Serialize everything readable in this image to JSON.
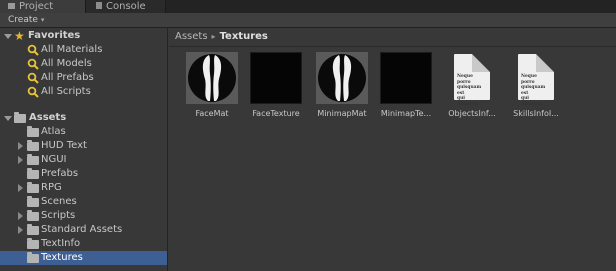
{
  "tabs": [
    {
      "label": "Project"
    },
    {
      "label": "Console"
    }
  ],
  "toolbar": {
    "create_label": "Create",
    "create_caret": "▾"
  },
  "favorites": {
    "header": "Favorites",
    "items": [
      {
        "label": "All Materials"
      },
      {
        "label": "All Models"
      },
      {
        "label": "All Prefabs"
      },
      {
        "label": "All Scripts"
      }
    ]
  },
  "assets": {
    "header": "Assets",
    "items": [
      {
        "label": "Atlas",
        "expandable": false
      },
      {
        "label": "HUD Text",
        "expandable": true
      },
      {
        "label": "NGUI",
        "expandable": true
      },
      {
        "label": "Prefabs",
        "expandable": false
      },
      {
        "label": "RPG",
        "expandable": true
      },
      {
        "label": "Scenes",
        "expandable": false
      },
      {
        "label": "Scripts",
        "expandable": true
      },
      {
        "label": "Standard Assets",
        "expandable": true
      },
      {
        "label": "TextInfo",
        "expandable": false
      },
      {
        "label": "Textures",
        "expandable": false,
        "selected": true
      }
    ]
  },
  "breadcrumb": {
    "root": "Assets",
    "separator": "▸",
    "current": "Textures"
  },
  "files": [
    {
      "name": "FaceMat",
      "kind": "material-sphere"
    },
    {
      "name": "FaceTexture",
      "kind": "texture-black"
    },
    {
      "name": "MinimapMat",
      "kind": "material-sphere"
    },
    {
      "name": "MinimapTe...",
      "kind": "texture-black"
    },
    {
      "name": "ObjectsInf...",
      "kind": "text-document",
      "preview": "Neque porro\nquisquam est\nqui dolorem."
    },
    {
      "name": "SkillsInfoI...",
      "kind": "text-document",
      "preview": "Neque porro\nquisquam est\nqui dolorem."
    }
  ],
  "colors": {
    "selection": "#3e5f94",
    "star": "#e5b52a",
    "search_icon": "#e8c33b"
  }
}
